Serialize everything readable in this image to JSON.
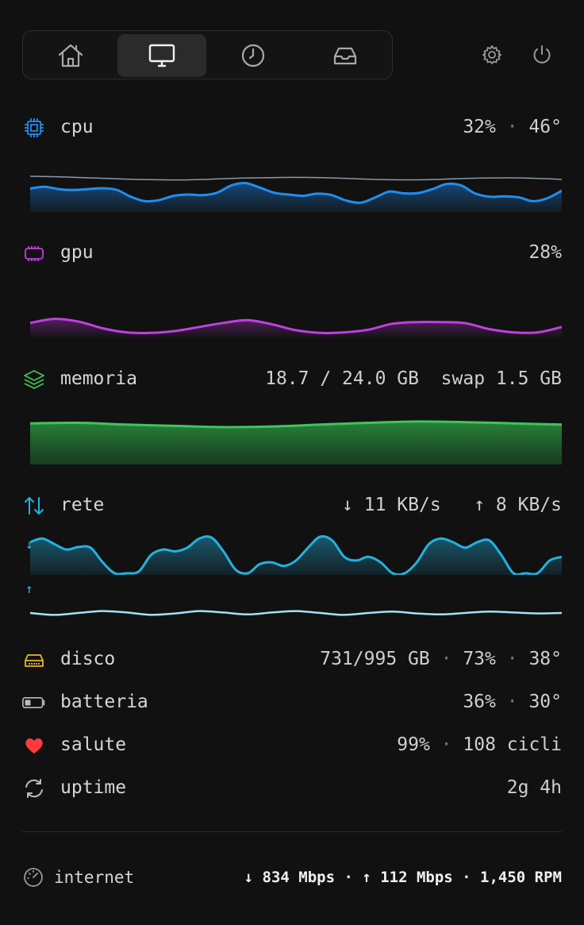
{
  "tabs": [
    {
      "name": "home",
      "icon": "home-icon",
      "active": false
    },
    {
      "name": "monitor",
      "icon": "monitor-icon",
      "active": true
    },
    {
      "name": "history",
      "icon": "clock-icon",
      "active": false
    },
    {
      "name": "inbox",
      "icon": "inbox-icon",
      "active": false
    }
  ],
  "top_icons": [
    "gear-icon",
    "power-icon"
  ],
  "cpu": {
    "label": "cpu",
    "usage": "32%",
    "temp": "46°",
    "color": "#1f8ef1",
    "usage_series": [
      0.62,
      0.68,
      0.6,
      0.57,
      0.6,
      0.63,
      0.58,
      0.35,
      0.2,
      0.24,
      0.38,
      0.42,
      0.4,
      0.48,
      0.72,
      0.8,
      0.65,
      0.48,
      0.42,
      0.38,
      0.45,
      0.4,
      0.22,
      0.15,
      0.32,
      0.52,
      0.46,
      0.47,
      0.6,
      0.77,
      0.72,
      0.45,
      0.35,
      0.36,
      0.33,
      0.2,
      0.3,
      0.55
    ],
    "temp_series": [
      0.82,
      0.8,
      0.76,
      0.72,
      0.68,
      0.66,
      0.66,
      0.7,
      0.74,
      0.76,
      0.77,
      0.76,
      0.72,
      0.68,
      0.66,
      0.67,
      0.71,
      0.74,
      0.75,
      0.73,
      0.68
    ]
  },
  "gpu": {
    "label": "gpu",
    "usage": "28%",
    "color": "#c13fe0",
    "series": [
      0.45,
      0.6,
      0.5,
      0.25,
      0.1,
      0.08,
      0.15,
      0.3,
      0.45,
      0.55,
      0.4,
      0.18,
      0.08,
      0.1,
      0.2,
      0.42,
      0.48,
      0.48,
      0.44,
      0.22,
      0.1,
      0.1,
      0.3
    ]
  },
  "memory": {
    "label": "memoria",
    "used": "18.7 / 24.0 GB",
    "swap": "swap 1.5 GB",
    "color": "#3fc45a",
    "series": [
      0.92,
      0.93,
      0.9,
      0.88,
      0.86,
      0.87,
      0.9,
      0.93,
      0.95,
      0.94,
      0.92,
      0.9
    ]
  },
  "network": {
    "label": "rete",
    "down": "↓ 11 KB/s",
    "up": "↑ 8 KB/s",
    "color": "#22b2e0",
    "down_arrow": "↓",
    "up_arrow": "↑",
    "down_series": [
      0.85,
      0.95,
      0.8,
      0.65,
      0.72,
      0.7,
      0.3,
      0.0,
      0.0,
      0.05,
      0.5,
      0.65,
      0.6,
      0.7,
      0.95,
      0.98,
      0.6,
      0.1,
      0.0,
      0.25,
      0.3,
      0.2,
      0.35,
      0.7,
      1.0,
      0.9,
      0.45,
      0.35,
      0.45,
      0.3,
      0.0,
      0.0,
      0.3,
      0.8,
      0.95,
      0.85,
      0.7,
      0.85,
      0.9,
      0.5,
      0.0,
      0.0,
      0.0,
      0.35,
      0.45
    ],
    "up_series": [
      0.5,
      0.3,
      0.5,
      0.7,
      0.55,
      0.3,
      0.45,
      0.7,
      0.55,
      0.35,
      0.55,
      0.7,
      0.5,
      0.3,
      0.5,
      0.65,
      0.45,
      0.35,
      0.5,
      0.65,
      0.55,
      0.45,
      0.5
    ]
  },
  "disk": {
    "label": "disco",
    "value": "731/995 GB",
    "percent": "73%",
    "temp": "38°",
    "color": "#e7b62c"
  },
  "battery": {
    "label": "batteria",
    "percent": "36%",
    "temp": "30°",
    "level": 0.36
  },
  "health": {
    "label": "salute",
    "percent": "99%",
    "cycles": "108 cicli",
    "color": "#ff3b3b"
  },
  "uptime": {
    "label": "uptime",
    "value": "2g 4h"
  },
  "footer": {
    "label": "internet",
    "value": "↓ 834 Mbps · ↑ 112 Mbps · 1,450 RPM"
  },
  "separator": "·"
}
